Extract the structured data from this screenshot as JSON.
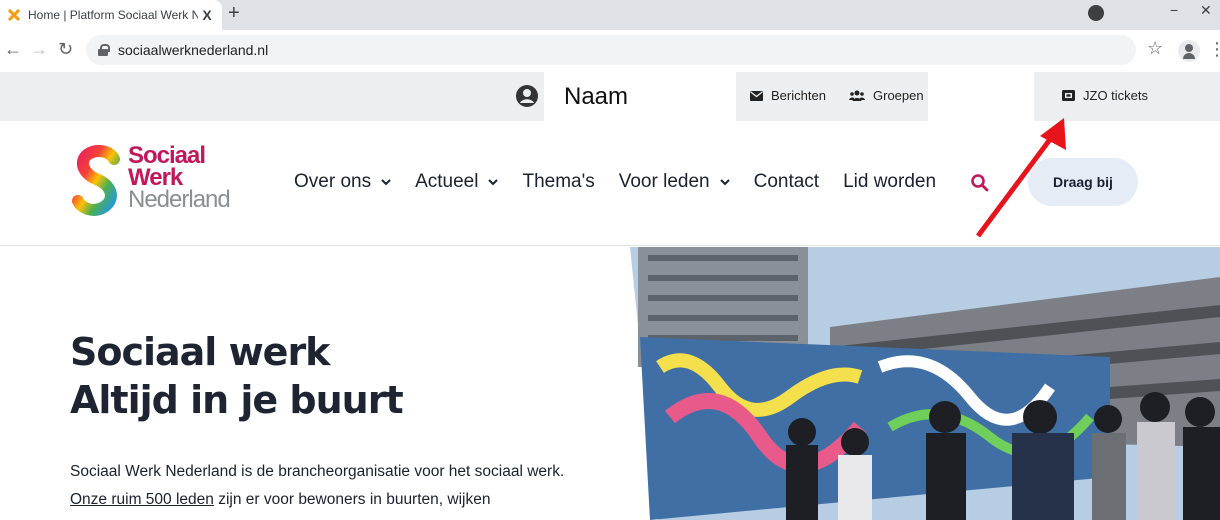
{
  "browser": {
    "tab_title": "Home | Platform Sociaal Werk Ne",
    "tab_close": "X",
    "new_tab": "+",
    "url": "sociaalwerknederland.nl"
  },
  "utility_bar": {
    "name": "Naam",
    "berichten": "Berichten",
    "groepen": "Groepen",
    "jzo_tickets": "JZO tickets"
  },
  "logo": {
    "line1": "Sociaal",
    "line2": "Werk",
    "line3": "Nederland"
  },
  "nav": {
    "items": [
      {
        "label": "Over ons",
        "dropdown": true
      },
      {
        "label": "Actueel",
        "dropdown": true
      },
      {
        "label": "Thema's",
        "dropdown": false
      },
      {
        "label": "Voor leden",
        "dropdown": true
      },
      {
        "label": "Contact",
        "dropdown": false
      },
      {
        "label": "Lid worden",
        "dropdown": false
      }
    ],
    "cta": "Draag bij"
  },
  "hero": {
    "title_line1": "Sociaal werk",
    "title_line2": "Altijd in je buurt",
    "text_pre": "Sociaal Werk Nederland is de brancheorganisatie voor het sociaal werk.",
    "link": "Onze ruim 500 leden",
    "text_post": "zijn er voor bewoners in buurten, wijken"
  },
  "colors": {
    "brand_magenta": "#c2185b",
    "brand_grey": "#8a8f94",
    "cta_bg": "#e5ecf5",
    "annotation_arrow": "#e8141c"
  }
}
